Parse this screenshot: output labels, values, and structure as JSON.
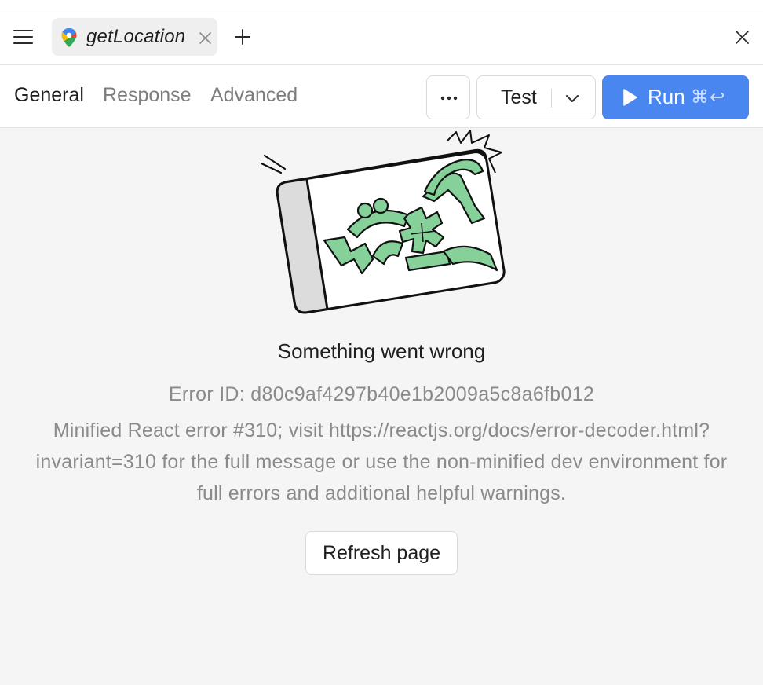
{
  "tabbar": {
    "menu_icon": "hamburger-menu-icon",
    "tab": {
      "label": "getLocation",
      "icon": "google-maps-pin-icon",
      "close_icon": "close-icon"
    },
    "add_icon": "plus-icon",
    "close_window_icon": "close-icon"
  },
  "toolbar": {
    "tabs": [
      {
        "label": "General",
        "active": true
      },
      {
        "label": "Response",
        "active": false
      },
      {
        "label": "Advanced",
        "active": false
      }
    ],
    "more_icon": "ellipsis-icon",
    "environment": {
      "selected": "Test",
      "icon": "chevron-down-icon"
    },
    "run": {
      "label": "Run",
      "shortcut": "⌘↩",
      "icon": "play-icon"
    }
  },
  "error": {
    "title": "Something went wrong",
    "id_line": "Error ID: d80c9af4297b40e1b2009a5c8a6fb012",
    "message": "Minified React error #310; visit https://reactjs.org/docs/error-decoder.html?invariant=310 for the full message or use the non-minified dev environment for full errors and additional helpful warnings.",
    "refresh_label": "Refresh page"
  },
  "colors": {
    "accent": "#4a86f0",
    "illustration_green": "#86d19a",
    "background": "#f5f5f5"
  }
}
